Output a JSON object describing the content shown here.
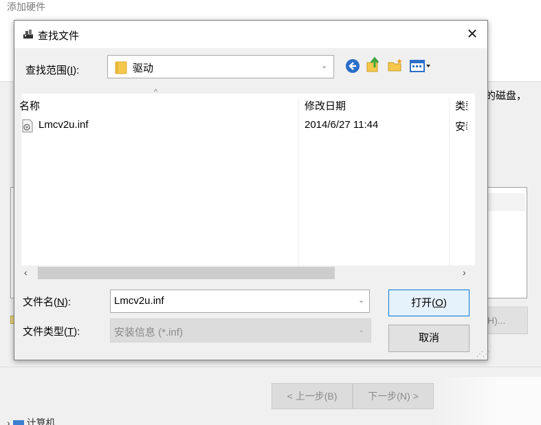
{
  "wizard": {
    "title": "添加硬件",
    "partial_text": "的磁盘，",
    "have_disk_label": "H)...",
    "back_label": "< 上一步(B)",
    "next_label": "下一步(N) >",
    "tree_item": "计算机"
  },
  "dialog": {
    "title": "查找文件",
    "close_glyph": "✕",
    "lookin": {
      "label_pre": "查找范围(",
      "label_key": "I",
      "label_post": "):",
      "value": "驱动"
    },
    "columns": {
      "name": "名称",
      "date": "修改日期",
      "type": "类型"
    },
    "files": [
      {
        "name": "Lmcv2u.inf",
        "date": "2014/6/27 11:44",
        "type": "安装信息"
      }
    ],
    "filename": {
      "label_pre": "文件名(",
      "label_key": "N",
      "label_post": "):",
      "value": "Lmcv2u.inf"
    },
    "filetype": {
      "label_pre": "文件类型(",
      "label_key": "T",
      "label_post": "):",
      "value": "安装信息 (*.inf)"
    },
    "open_button": {
      "pre": "打开(",
      "key": "O",
      "post": ")"
    },
    "cancel_button": "取消",
    "icons": {
      "dialog": "find-file-icon",
      "folder": "folder-icon",
      "back": "back-arrow-icon",
      "up": "up-folder-icon",
      "new_folder": "new-folder-icon",
      "view": "view-menu-icon",
      "file": "inf-file-icon"
    },
    "colors": {
      "accent": "#0078d7",
      "folder": "#f5c84c",
      "back_icon": "#2a6fc9",
      "up_icon": "#3aa33a"
    }
  }
}
